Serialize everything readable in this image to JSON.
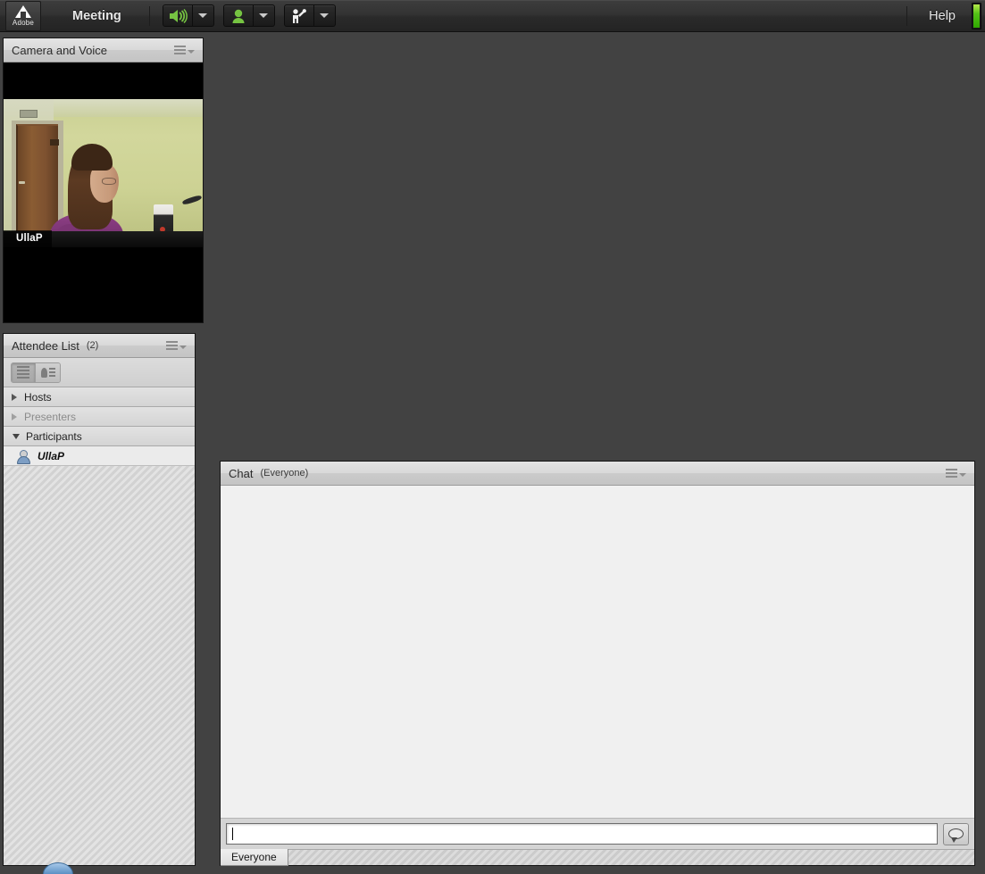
{
  "app": {
    "brand": "Adobe",
    "window_title": "Meeting"
  },
  "menubar": {
    "logo_label": "Adobe",
    "meeting_label": "Meeting",
    "help_label": "Help",
    "tools": [
      {
        "name": "speaker",
        "icon": "speaker-icon",
        "state": "on",
        "color": "#76c442"
      },
      {
        "name": "webcam",
        "icon": "webcam-icon",
        "state": "on",
        "color": "#76c442"
      },
      {
        "name": "raise-hand",
        "icon": "raise-hand-icon",
        "state": "off",
        "color": "#e8e8e8"
      }
    ],
    "connection_status": "good",
    "connection_color": "#54c118"
  },
  "camera_pod": {
    "title": "Camera and Voice",
    "menu_icon": "pod-options-icon",
    "video": {
      "participant_name": "UllaP",
      "has_feed": true
    }
  },
  "attendee_pod": {
    "title": "Attendee List",
    "count_label": "(2)",
    "menu_icon": "pod-options-icon",
    "view_buttons": [
      {
        "name": "list-view",
        "icon": "list-view-icon",
        "active": true
      },
      {
        "name": "card-view",
        "icon": "card-view-icon",
        "active": false
      }
    ],
    "groups": [
      {
        "label": "Hosts",
        "expanded": false,
        "dimmed": false,
        "members": []
      },
      {
        "label": "Presenters",
        "expanded": false,
        "dimmed": true,
        "members": []
      },
      {
        "label": "Participants",
        "expanded": true,
        "dimmed": false,
        "members": [
          {
            "name": "UllaP",
            "icon": "participant-avatar-icon"
          }
        ]
      }
    ]
  },
  "chat_pod": {
    "title": "Chat",
    "scope_label": "(Everyone)",
    "menu_icon": "pod-options-icon",
    "messages": [],
    "input": {
      "value": "",
      "placeholder": ""
    },
    "send_button_icon": "chat-bubble-icon",
    "tabs": [
      {
        "label": "Everyone",
        "active": true
      }
    ]
  },
  "stage": {
    "background_color": "#424242"
  }
}
